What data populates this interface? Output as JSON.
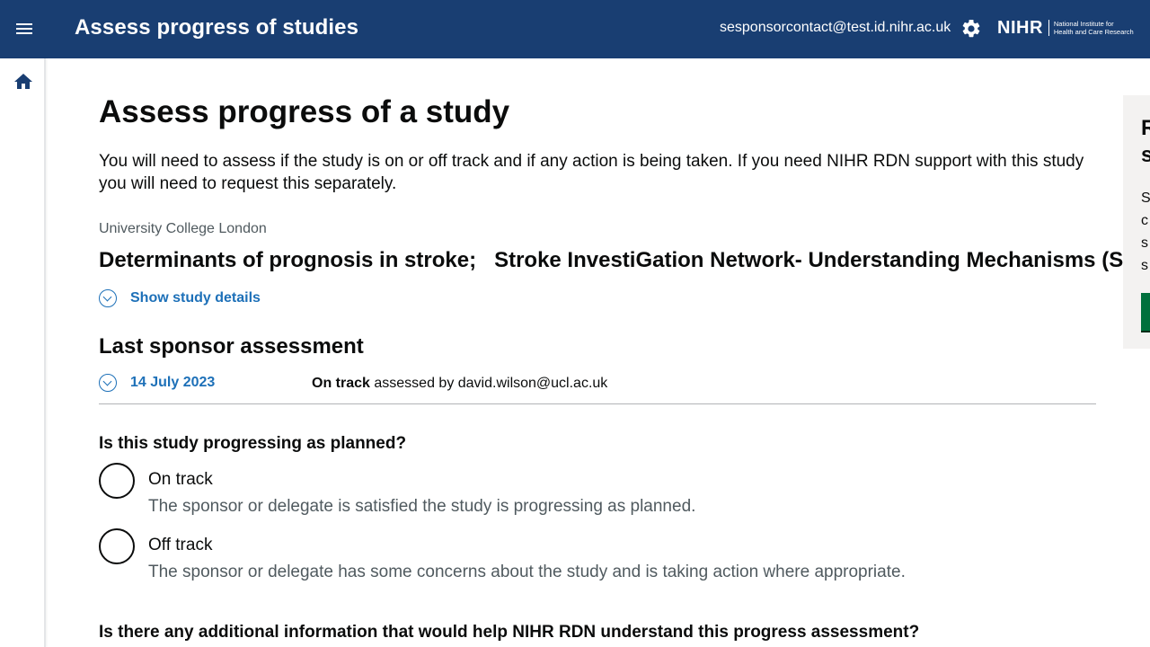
{
  "header": {
    "app_title": "Assess progress of studies",
    "user_email": "sesponsorcontact@test.id.nihr.ac.uk",
    "logo_mark": "NIHR",
    "logo_text_line1": "National Institute for",
    "logo_text_line2": "Health and Care Research",
    "icons": [
      "menu-icon",
      "gear-icon"
    ],
    "background": "#193e72"
  },
  "sidebar": {
    "icons": [
      "home-icon"
    ]
  },
  "main": {
    "page_title": "Assess progress of a study",
    "intro": "You will need to assess if the study is on or off track and if any action is being taken. If you need NIHR RDN support with this study you will need to request this separately.",
    "organisation": "University College London",
    "study_title": "Determinants of prognosis in stroke;   Stroke InvestiGation Network- Understanding Mechanisms (SIGNUM",
    "show_details_label": "Show study details",
    "last_assessment": {
      "heading": "Last sponsor assessment",
      "date": "14 July 2023",
      "status": "On track",
      "assessed_by_text": "assessed by david.wilson@ucl.ac.uk"
    },
    "question_progress": "Is this study progressing as planned?",
    "options": [
      {
        "label": "On track",
        "hint": "The sponsor or delegate is satisfied the study is progressing as planned.",
        "selected": false
      },
      {
        "label": "Off track",
        "hint": "The sponsor or delegate has some concerns about the study and is taking action where appropriate.",
        "selected": false
      }
    ],
    "question_additional": "Is there any additional information that would help NIHR RDN understand this progress assessment?"
  },
  "side_panel": {
    "title": "R\ns",
    "body": "S\nc\ns\ns",
    "button_color": "#00703c"
  },
  "colors": {
    "link": "#1d70b8",
    "text": "#0b0c0c",
    "secondary_text": "#505a5f"
  }
}
